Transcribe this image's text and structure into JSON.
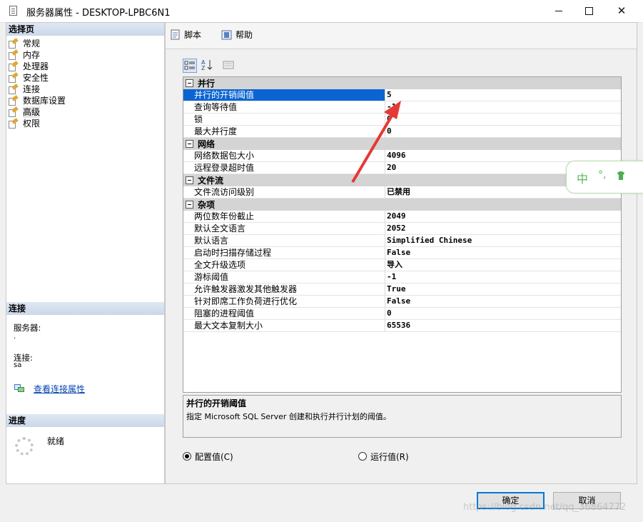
{
  "window": {
    "title": "服务器属性 - DESKTOP-LPBC6N1",
    "minimize": "—",
    "maximize": "□",
    "close": "✕"
  },
  "left": {
    "pages_header": "选择页",
    "pages": [
      "常规",
      "内存",
      "处理器",
      "安全性",
      "连接",
      "数据库设置",
      "高级",
      "权限"
    ],
    "selected_page": "高级",
    "connection_header": "连接",
    "server_label": "服务器:",
    "server_value": ".",
    "login_label": "连接:",
    "login_value": "sa",
    "view_link": "查看连接属性",
    "progress_header": "进度",
    "progress_status": "就绪"
  },
  "toolbar": {
    "script_label": "脚本",
    "help_label": "帮助"
  },
  "grid": {
    "categories": [
      {
        "name": "并行",
        "rows": [
          {
            "name": "并行的开销阈值",
            "value": "5",
            "selected": true
          },
          {
            "name": "查询等待值",
            "value": "-1"
          },
          {
            "name": "锁",
            "value": "0"
          },
          {
            "name": "最大并行度",
            "value": "0"
          }
        ]
      },
      {
        "name": "网络",
        "rows": [
          {
            "name": "网络数据包大小",
            "value": "4096"
          },
          {
            "name": "远程登录超时值",
            "value": "20"
          }
        ]
      },
      {
        "name": "文件流",
        "rows": [
          {
            "name": "文件流访问级别",
            "value": "已禁用"
          }
        ]
      },
      {
        "name": "杂项",
        "rows": [
          {
            "name": "两位数年份截止",
            "value": "2049"
          },
          {
            "name": "默认全文语言",
            "value": "2052"
          },
          {
            "name": "默认语言",
            "value": "Simplified Chinese"
          },
          {
            "name": "启动时扫描存储过程",
            "value": "False"
          },
          {
            "name": "全文升级选项",
            "value": "导入"
          },
          {
            "name": "游标阈值",
            "value": "-1"
          },
          {
            "name": "允许触发器激发其他触发器",
            "value": "True"
          },
          {
            "name": "针对即席工作负荷进行优化",
            "value": "False"
          },
          {
            "name": "阻塞的进程阈值",
            "value": "0"
          },
          {
            "name": "最大文本复制大小",
            "value": "65536"
          }
        ]
      }
    ]
  },
  "description": {
    "title": "并行的开销阈值",
    "text": "指定 Microsoft SQL Server 创建和执行并行计划的阈值。"
  },
  "radios": {
    "configured": "配置值(C)",
    "running": "运行值(R)",
    "selected": "configured"
  },
  "buttons": {
    "ok": "确定",
    "cancel": "取消"
  },
  "ime": {
    "lang": "中",
    "punct": "°,"
  },
  "watermark": "https://blog.csdn.net/qq_36864772",
  "colors": {
    "selection": "#0a64d2",
    "category_bg": "#d4d4d4",
    "arrow": "#e53935",
    "link": "#0645ad"
  }
}
